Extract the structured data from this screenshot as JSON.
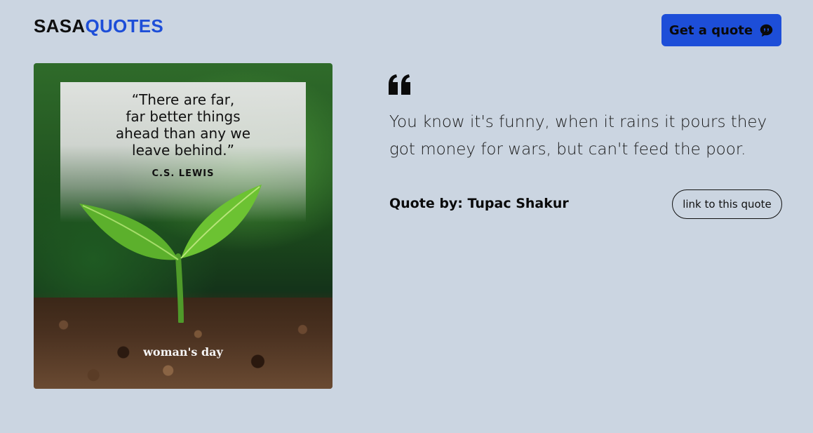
{
  "header": {
    "logo_part1": "SASA",
    "logo_part2": "QUOTES",
    "get_quote_label": "Get a quote",
    "get_quote_icon": "chat-bubble-icon"
  },
  "image": {
    "quote_text": "“There are far,\nfar better things\nahead than any we\nleave behind.”",
    "quote_author": "C.S. LEWIS",
    "brand": "woman's day"
  },
  "quote": {
    "icon": "quote-mark-icon",
    "text": "You know it's funny, when it rains it pours they got money for wars, but can't feed the poor.",
    "by": "Quote by: Tupac Shakur",
    "link_label": "link to this quote"
  },
  "colors": {
    "background": "#cbd5e1",
    "accent": "#1d4ed8"
  }
}
